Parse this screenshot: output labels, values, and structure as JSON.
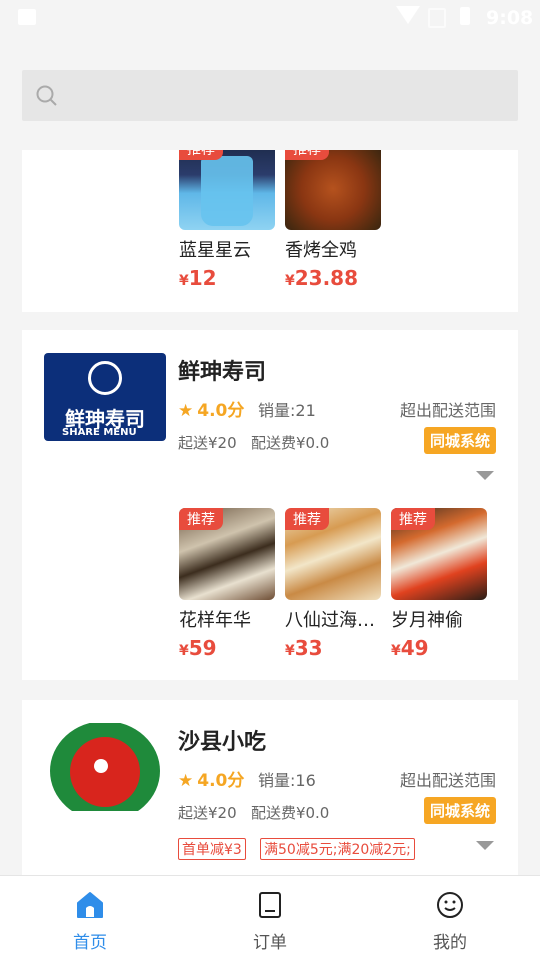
{
  "status_bar": {
    "time": "9:08"
  },
  "search": {
    "placeholder": ""
  },
  "card1": {
    "dishes": [
      {
        "tag": "推荐",
        "name": "蓝星星云",
        "currency": "¥",
        "price": "12"
      },
      {
        "tag": "推荐",
        "name": "香烤全鸡",
        "currency": "¥",
        "price": "23.88"
      }
    ]
  },
  "card2": {
    "name": "鲜珅寿司",
    "logo_text": "鲜珅寿司",
    "logo_sub": "SHARE MENU",
    "rating": "4.0分",
    "sales": "销量:21",
    "range": "超出配送范围",
    "min_order": "起送¥20",
    "delivery_fee": "配送费¥0.0",
    "badge": "同城系统",
    "dishes": [
      {
        "tag": "推荐",
        "name": "花样年华",
        "currency": "¥",
        "price": "59"
      },
      {
        "tag": "推荐",
        "name": "八仙过海…",
        "currency": "¥",
        "price": "33"
      },
      {
        "tag": "推荐",
        "name": "岁月神偷",
        "currency": "¥",
        "price": "49"
      }
    ]
  },
  "card3": {
    "name": "沙县小吃",
    "rating": "4.0分",
    "sales": "销量:16",
    "range": "超出配送范围",
    "min_order": "起送¥20",
    "delivery_fee": "配送费¥0.0",
    "badge": "同城系统",
    "promos": [
      "首单减¥3",
      "满50减5元;满20减2元;"
    ]
  },
  "tabbar": {
    "tabs": [
      {
        "label": "首页",
        "icon": "home-icon",
        "active": true
      },
      {
        "label": "订单",
        "icon": "order-icon",
        "active": false
      },
      {
        "label": "我的",
        "icon": "profile-icon",
        "active": false
      }
    ]
  },
  "colors": {
    "accent": "#2f8de9",
    "price": "#e84c3d",
    "badge": "#f6a623",
    "star": "#f5a623"
  }
}
